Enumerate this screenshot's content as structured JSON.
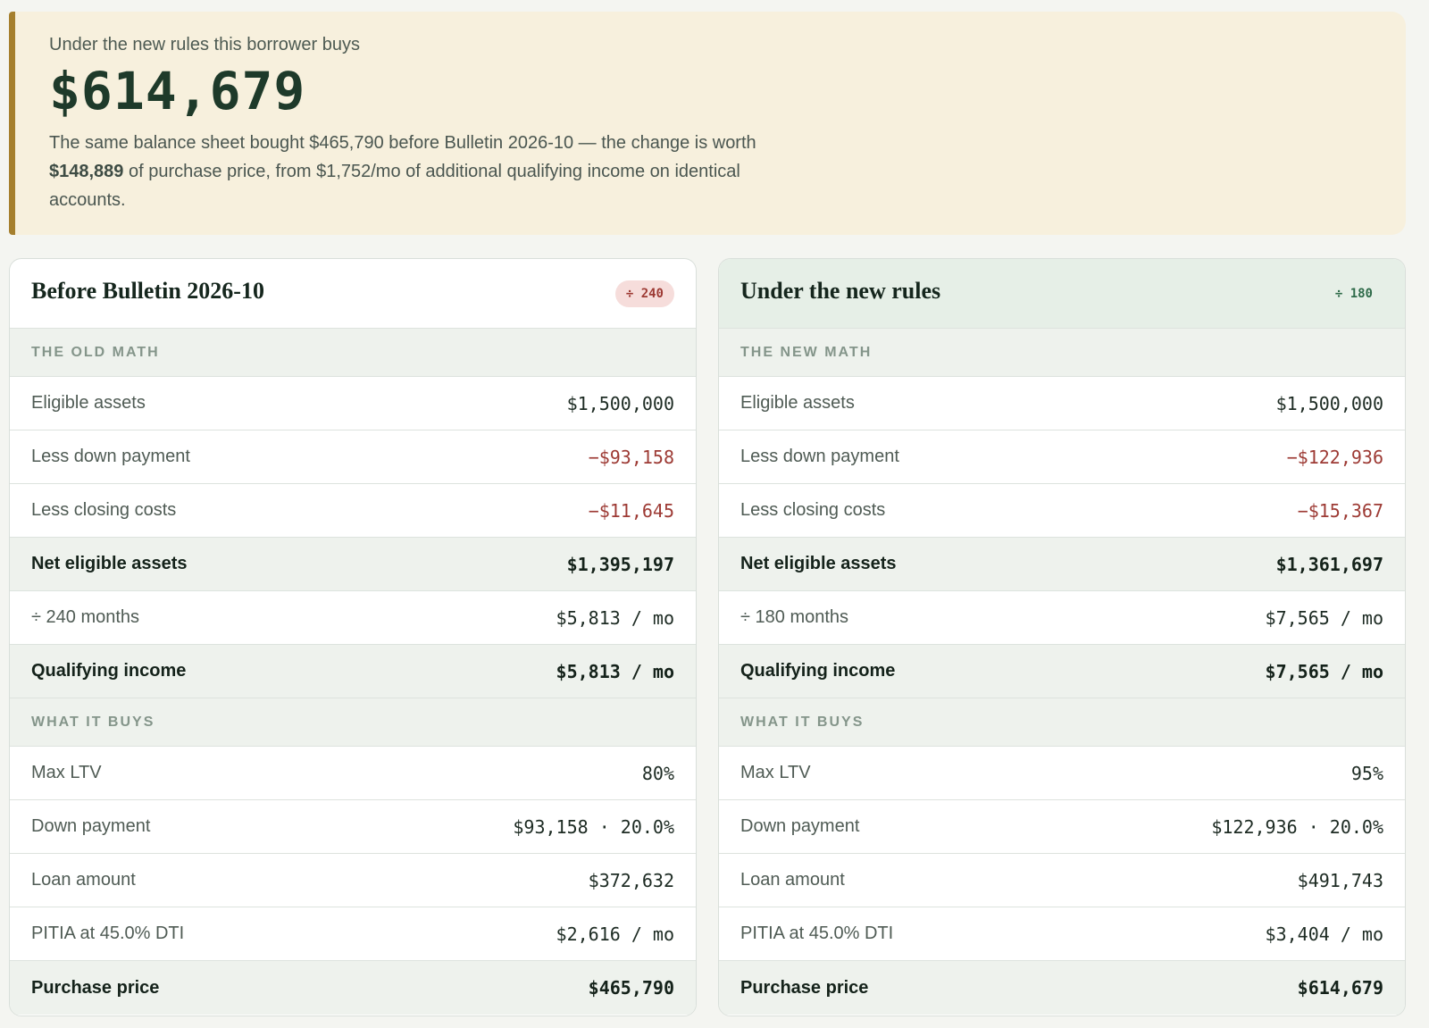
{
  "hero": {
    "kicker": "Under the new rules this borrower buys",
    "amount": "$614,679",
    "desc_1": "The same balance sheet bought $465,790 before Bulletin 2026-10 — the change is worth ",
    "desc_bold": "$148,889",
    "desc_2": " of purchase price, from $1,752/mo of additional qualifying income on identical accounts."
  },
  "before": {
    "title": "Before Bulletin 2026-10",
    "badge": "÷ 240",
    "section_math": "THE OLD MATH",
    "section_buys": "WHAT IT BUYS",
    "rows_math": [
      {
        "label": "Eligible assets",
        "value": "$1,500,000"
      },
      {
        "label": "Less down payment",
        "value": "−$93,158"
      },
      {
        "label": "Less closing costs",
        "value": "−$11,645"
      },
      {
        "label": "Net eligible assets",
        "value": "$1,395,197"
      },
      {
        "label": "÷ 240 months",
        "value": "$5,813 / mo"
      },
      {
        "label": "Qualifying income",
        "value": "$5,813 / mo"
      }
    ],
    "rows_buys": [
      {
        "label": "Max LTV",
        "value": "80%"
      },
      {
        "label": "Down payment",
        "value": "$93,158 · 20.0%"
      },
      {
        "label": "Loan amount",
        "value": "$372,632"
      },
      {
        "label": "PITIA at 45.0% DTI",
        "value": "$2,616 / mo"
      },
      {
        "label": "Purchase price",
        "value": "$465,790"
      }
    ]
  },
  "after": {
    "title": "Under the new rules",
    "badge": "÷ 180",
    "section_math": "THE NEW MATH",
    "section_buys": "WHAT IT BUYS",
    "rows_math": [
      {
        "label": "Eligible assets",
        "value": "$1,500,000"
      },
      {
        "label": "Less down payment",
        "value": "−$122,936"
      },
      {
        "label": "Less closing costs",
        "value": "−$15,367"
      },
      {
        "label": "Net eligible assets",
        "value": "$1,361,697"
      },
      {
        "label": "÷ 180 months",
        "value": "$7,565 / mo"
      },
      {
        "label": "Qualifying income",
        "value": "$7,565 / mo"
      }
    ],
    "rows_buys": [
      {
        "label": "Max LTV",
        "value": "95%"
      },
      {
        "label": "Down payment",
        "value": "$122,936 · 20.0%"
      },
      {
        "label": "Loan amount",
        "value": "$491,743"
      },
      {
        "label": "PITIA at 45.0% DTI",
        "value": "$3,404 / mo"
      },
      {
        "label": "Purchase price",
        "value": "$614,679"
      }
    ]
  },
  "colors": {
    "accent_gold": "#a57f2d",
    "negative_red": "#9d3a34",
    "positive_green": "#2f6b4a",
    "hero_bg": "#f7f0dd"
  }
}
